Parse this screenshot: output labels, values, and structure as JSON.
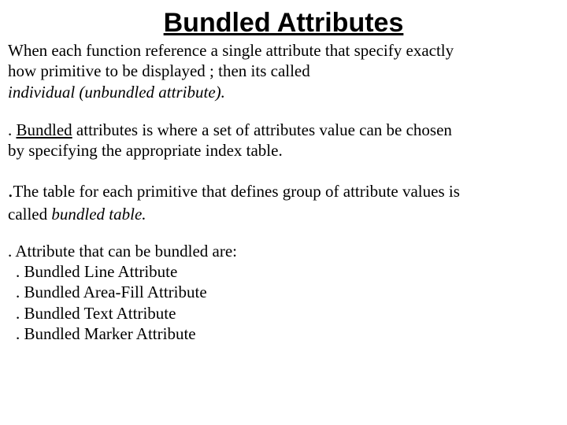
{
  "title": "Bundled Attributes",
  "para1": {
    "line1": "When each function reference a single attribute that specify exactly",
    "line2": " how primitive to be displayed ; then its called",
    "line3_italic": "  individual (unbundled attribute)."
  },
  "para2": {
    "dot": ". ",
    "term": "Bundled",
    "rest_line1": " attributes is where a set of attributes value can be chosen",
    "line2": " by specifying the   appropriate index table."
  },
  "para3": {
    "dot": ".",
    "line1_after_dot": "The table for each primitive that defines group of attribute values is",
    "line2_plain": " called ",
    "line2_italic": "bundled table."
  },
  "list": {
    "heading": ". Attribute that can be bundled are:",
    "items": [
      ". Bundled Line Attribute",
      ". Bundled Area-Fill Attribute",
      ". Bundled Text Attribute",
      ". Bundled Marker Attribute"
    ]
  }
}
